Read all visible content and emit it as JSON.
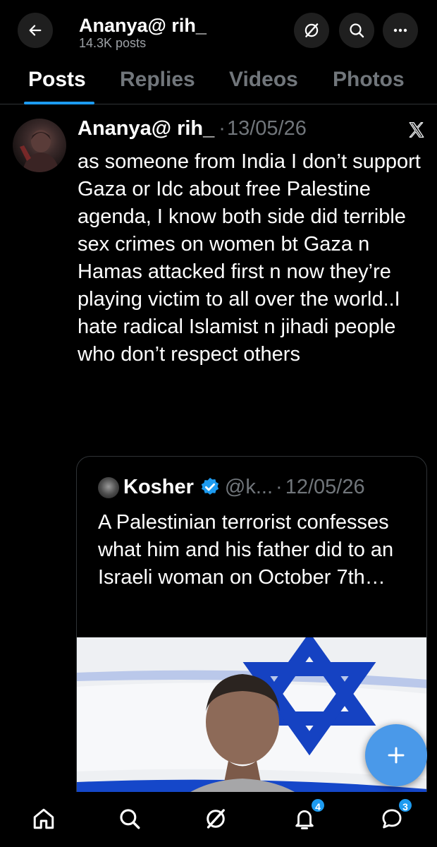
{
  "header": {
    "name": "Ananya@ rih_",
    "post_count": "14.3K posts",
    "back_icon": "arrow-left-icon",
    "grok_icon": "grok-icon",
    "search_icon": "search-icon",
    "more_icon": "more-horizontal-icon"
  },
  "tabs": [
    {
      "label": "Posts",
      "active": true
    },
    {
      "label": "Replies",
      "active": false
    },
    {
      "label": "Videos",
      "active": false
    },
    {
      "label": "Photos",
      "active": false
    }
  ],
  "post": {
    "author": "Ananya@ rih_",
    "date": "13/05/26",
    "separator": "·",
    "text": "as someone from India I don’t support Gaza or Idc about free Palestine agenda, I know both side did terrible sex crimes on women bt Gaza n Hamas attacked first n now they’re playing victim to all over the world..I hate radical Islamist n jihadi people who don’t respect others",
    "source_icon": "x-logo-icon",
    "quote": {
      "author": "Kosher",
      "handle": "@k...",
      "separator": "·",
      "date": "12/05/26",
      "verified_icon": "verified-badge-icon",
      "text": "A Palestinian terrorist confesses what him and his father did to an Israeli woman on October 7th…",
      "media": "video-thumbnail"
    }
  },
  "fab": {
    "icon": "plus-icon"
  },
  "bottom_nav": [
    {
      "icon": "home-icon"
    },
    {
      "icon": "search-icon"
    },
    {
      "icon": "grok-icon"
    },
    {
      "icon": "bell-icon",
      "badge": "4"
    },
    {
      "icon": "message-icon",
      "badge": "3"
    }
  ],
  "colors": {
    "background": "#000000",
    "accent": "#1d9bf0",
    "fab": "#4a99e9",
    "muted_text": "#71767b",
    "divider": "#2f3336"
  }
}
